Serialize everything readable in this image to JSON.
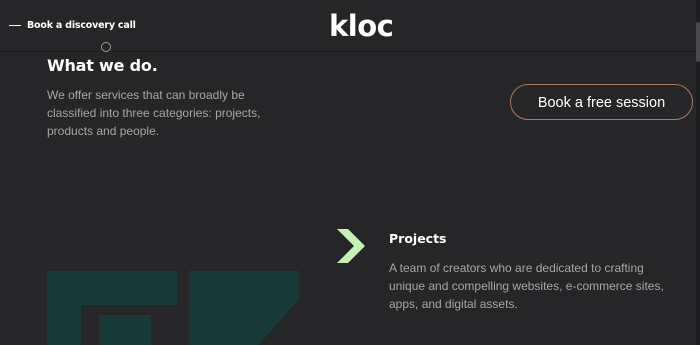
{
  "header": {
    "discovery_link": "Book a discovery call",
    "logo_text": "kloc",
    "logo_icon": "kloc-logo-icon"
  },
  "what_we_do": {
    "title": "What we do.",
    "description": "We offer services that can broadly be classified into three categories: projects, products and people.",
    "cta_label": "Book a free session"
  },
  "projects": {
    "icon": "chevron-right-icon",
    "title": "Projects",
    "description": "A team of creators who are dedicated to crafting unique and compelling websites, e-commerce sites, apps, and digital assets."
  },
  "colors": {
    "background": "#262629",
    "accent_green": "#c3f3b4",
    "button_border": "#b0765a",
    "muted_text": "#a6a6a6",
    "deco_teal": "#183a3b"
  }
}
